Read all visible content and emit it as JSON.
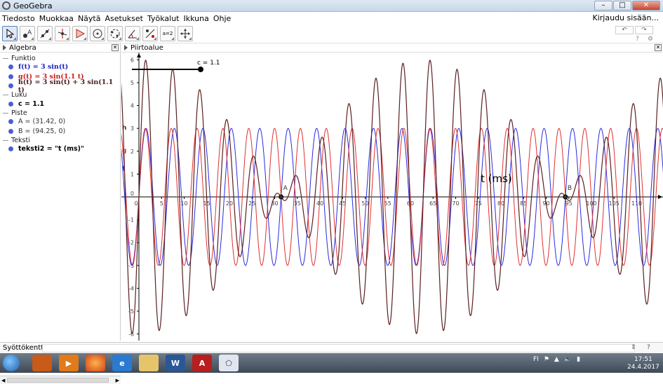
{
  "window": {
    "title": "GeoGebra",
    "buttons": [
      "–",
      "□",
      "✕"
    ]
  },
  "menu": {
    "items": [
      "Tiedosto",
      "Muokkaa",
      "Näytä",
      "Asetukset",
      "Työkalut",
      "Ikkuna",
      "Ohje"
    ],
    "login": "Kirjaudu sisään..."
  },
  "toolbar": {
    "tools": [
      "move-tool",
      "point-tool",
      "line-tool",
      "perpendicular-tool",
      "polygon-tool",
      "circle-tool",
      "conic-tool",
      "angle-tool",
      "reflect-tool",
      "slider-tool",
      "move-graphics-tool"
    ],
    "slider_icon_text": "a=2",
    "undo": "↶",
    "redo": "↷"
  },
  "algebra": {
    "title": "Algebra",
    "sections": [
      {
        "label": "Funktio",
        "items": [
          {
            "text": "f(t)  =  3 sin(t)",
            "color": "#1a1ac9"
          },
          {
            "text": "g(t)  =  3 sin(1.1 t)",
            "color": "#cc1a1a"
          },
          {
            "text": "h(t)  =  3 sin(t) + 3 sin(1.1 t)",
            "color": "#4a1a1a"
          }
        ]
      },
      {
        "label": "Luku",
        "items": [
          {
            "text": "c = 1.1",
            "color": "#000000"
          }
        ]
      },
      {
        "label": "Piste",
        "items": [
          {
            "text": "A = (31.42, 0)",
            "color": "#333333"
          },
          {
            "text": "B = (94.25, 0)",
            "color": "#333333"
          }
        ]
      },
      {
        "label": "Teksti",
        "items": [
          {
            "text": "teksti2 = \"t (ms)\"",
            "color": "#000000"
          }
        ]
      }
    ]
  },
  "graphics": {
    "title": "Piirtoalue",
    "slider_label": "c = 1.1",
    "text_label": "t (ms)",
    "point_A": "A",
    "point_B": "B",
    "fn_labels": {
      "h": "h",
      "g": "g",
      "f": "f"
    },
    "x_ticks": [
      0,
      5,
      10,
      15,
      20,
      25,
      30,
      35,
      40,
      45,
      50,
      55,
      60,
      65,
      70,
      75,
      80,
      85,
      90,
      95,
      100,
      105,
      110
    ],
    "y_ticks": [
      6,
      5,
      4,
      3,
      2,
      1,
      0,
      -1,
      -2,
      -3,
      -4,
      -5,
      -6
    ],
    "colors": {
      "f": "#2a2ae0",
      "g": "#e03030",
      "h": "#5a1f1f"
    }
  },
  "chart_data": {
    "type": "line",
    "title": "",
    "xlabel": "t (ms)",
    "ylabel": "",
    "xlim": [
      -2,
      115
    ],
    "ylim": [
      -6.5,
      6.5
    ],
    "series": [
      {
        "name": "f",
        "function": "3 sin(t)"
      },
      {
        "name": "g",
        "function": "3 sin(1.1 t)"
      },
      {
        "name": "h",
        "function": "3 sin(t) + 3 sin(1.1 t)"
      }
    ],
    "points": [
      {
        "name": "A",
        "x": 31.42,
        "y": 0
      },
      {
        "name": "B",
        "x": 94.25,
        "y": 0
      }
    ]
  },
  "inputbar": {
    "label": "Syöttökenttä:",
    "symbol": "⇕",
    "help": "?"
  },
  "taskbar": {
    "time": "17:51",
    "date": "24.4.2017",
    "lang": "FI"
  }
}
